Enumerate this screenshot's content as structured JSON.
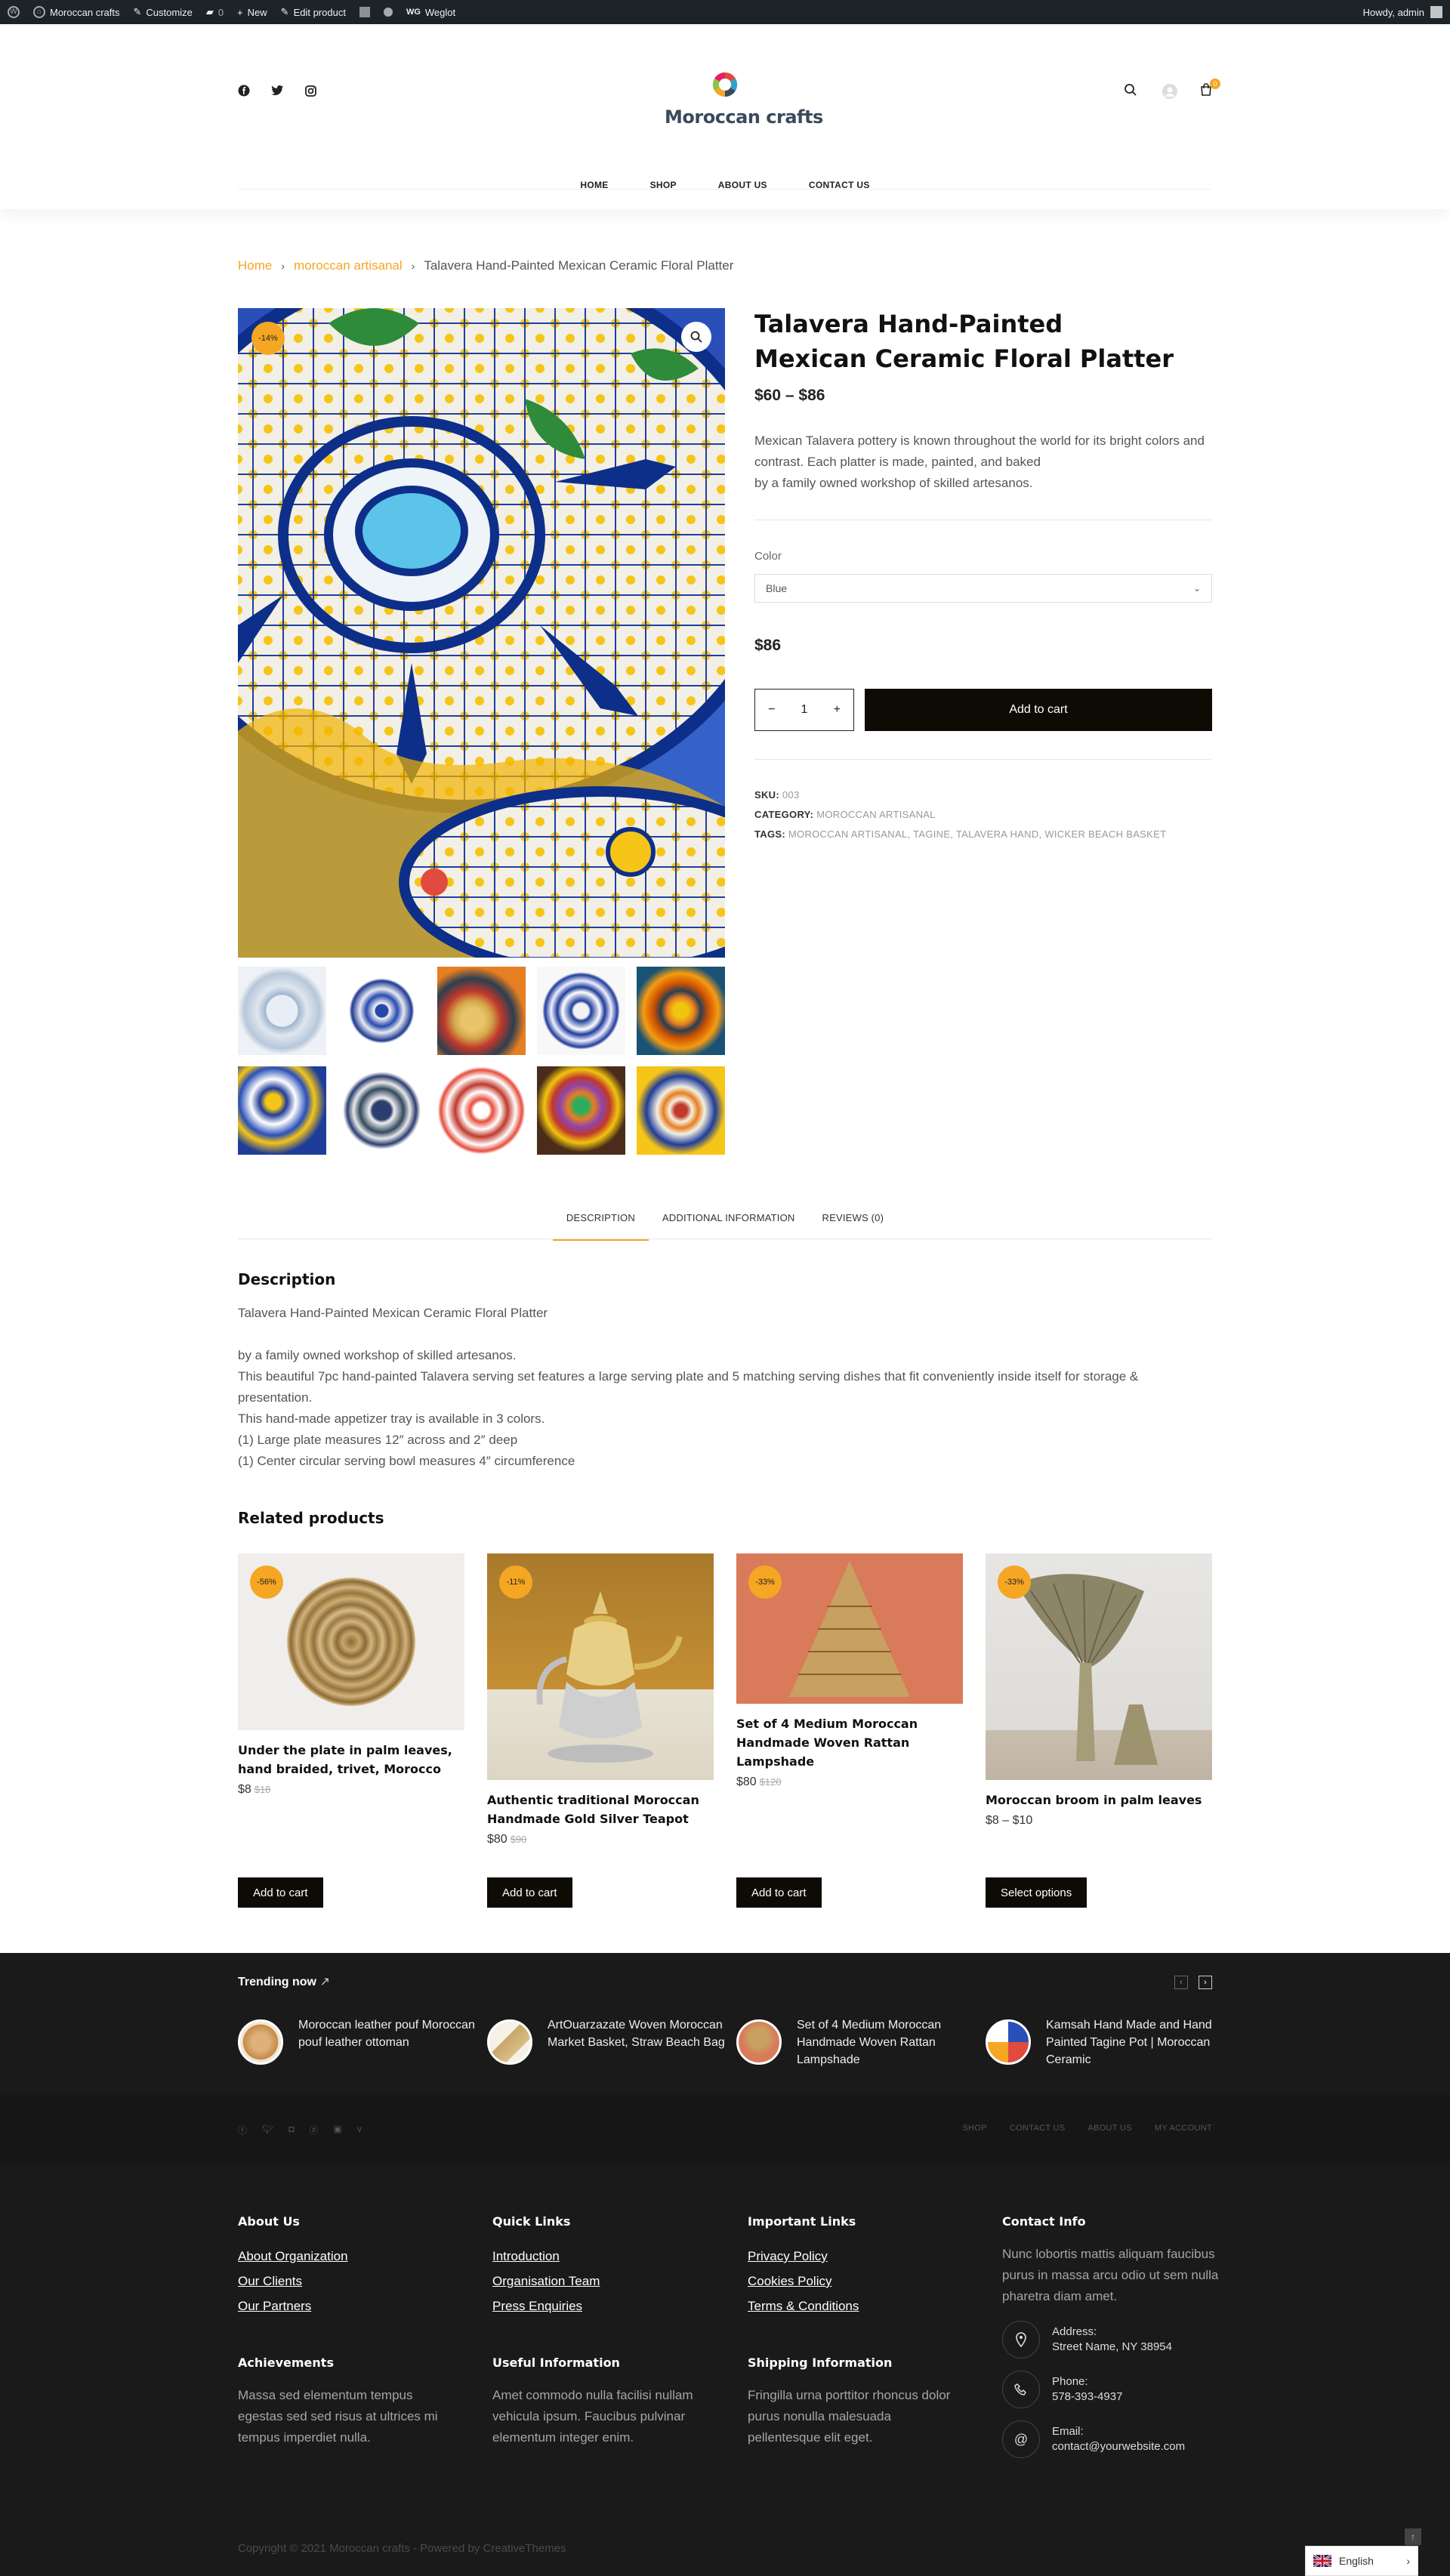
{
  "admin_bar": {
    "site_name": "Moroccan crafts",
    "customize": "Customize",
    "comments": "0",
    "new": "New",
    "edit_product": "Edit product",
    "weglot_badge": "WG",
    "weglot": "Weglot",
    "howdy": "Howdy, admin"
  },
  "header": {
    "logo_text": "Moroccan crafts",
    "cart_count": "0",
    "social_icons": [
      "facebook-icon",
      "twitter-icon",
      "instagram-icon"
    ]
  },
  "nav": {
    "items": [
      "HOME",
      "SHOP",
      "ABOUT US",
      "CONTACT US"
    ]
  },
  "breadcrumb": {
    "home": "Home",
    "category": "moroccan artisanal",
    "current": "Talavera Hand-Painted Mexican Ceramic Floral Platter"
  },
  "product": {
    "sale_badge": "-14%",
    "title": "Talavera Hand-Painted Mexican Ceramic Floral Platter",
    "price_range": "$60 – $86",
    "short_description": "Mexican Talavera pottery is known throughout the world for its bright colors and contrast. Each platter is made, painted, and baked\nby a family owned workshop of skilled artesanos.",
    "color_label": "Color",
    "color_selected": "Blue",
    "variation_price": "$86",
    "quantity": "1",
    "add_to_cart": "Add to cart",
    "sku_label": "SKU:",
    "sku": "003",
    "category_label": "CATEGORY:",
    "category": "MOROCCAN ARTISANAL",
    "tags_label": "TAGS:",
    "tags": "MOROCCAN ARTISANAL, TAGINE, TALAVERA HAND, WICKER BEACH BASKET"
  },
  "tabs": [
    "DESCRIPTION",
    "ADDITIONAL INFORMATION",
    "REVIEWS (0)"
  ],
  "description": {
    "title": "Description",
    "lines": [
      "Talavera Hand-Painted Mexican Ceramic Floral Platter",
      "",
      "by a family owned workshop of skilled artesanos.",
      "This beautiful 7pc hand-painted Talavera serving set features a large serving plate and 5 matching serving dishes that fit conveniently inside itself for storage & presentation.",
      "This hand-made appetizer tray is available in 3 colors.",
      "(1) Large plate measures 12″ across and 2″ deep",
      "(1) Center circular serving bowl measures 4″ circumference"
    ]
  },
  "related": {
    "title": "Related products",
    "products": [
      {
        "badge": "-56%",
        "name": "Under the plate in palm leaves, hand braided, trivet, Morocco",
        "price": "$8",
        "old_price": "$18",
        "button": "Add to cart"
      },
      {
        "badge": "-11%",
        "name": "Authentic traditional Moroccan Handmade Gold Silver Teapot",
        "price": "$80",
        "old_price": "$90",
        "button": "Add to cart"
      },
      {
        "badge": "-33%",
        "name": "Set of 4 Medium Moroccan Handmade Woven Rattan Lampshade",
        "price": "$80",
        "old_price": "$120",
        "button": "Add to cart"
      },
      {
        "badge": "-33%",
        "name": "Moroccan broom in palm leaves",
        "price": "$8 – $10",
        "old_price": "",
        "button": "Select options"
      }
    ]
  },
  "trending": {
    "title": "Trending now",
    "items": [
      "Moroccan leather pouf Moroccan pouf leather ottoman",
      "ArtOuarzazate Woven Moroccan Market Basket, Straw Beach Bag",
      "Set of 4 Medium Moroccan Handmade Woven Rattan Lampshade",
      "Kamsah Hand Made and Hand Painted Tagine Pot | Moroccan Ceramic"
    ]
  },
  "footer_bar": {
    "links": [
      "SHOP",
      "CONTACT US",
      "ABOUT US",
      "MY ACCOUNT"
    ],
    "social_icons": [
      "facebook-icon",
      "twitter-icon",
      "instagram-icon",
      "pinterest-icon",
      "youtube-icon",
      "vimeo-icon"
    ]
  },
  "footer": {
    "about": {
      "title": "About Us",
      "links": [
        "About Organization",
        "Our Clients",
        "Our Partners"
      ]
    },
    "quick": {
      "title": "Quick Links",
      "links": [
        "Introduction",
        "Organisation Team",
        "Press Enquiries"
      ]
    },
    "important": {
      "title": "Important Links",
      "links": [
        "Privacy Policy",
        "Cookies Policy",
        "Terms & Conditions"
      ]
    },
    "contact": {
      "title": "Contact Info",
      "text": "Nunc lobortis mattis aliquam faucibus purus in massa arcu odio ut sem nulla pharetra diam amet.",
      "address_label": "Address:",
      "address": "Street Name, NY 38954",
      "phone_label": "Phone:",
      "phone": "578-393-4937",
      "email_label": "Email:",
      "email": "contact@yourwebsite.com"
    },
    "achievements": {
      "title": "Achievements",
      "text": "Massa sed elementum tempus egestas sed sed risus at ultrices mi tempus imperdiet nulla."
    },
    "useful": {
      "title": "Useful Information",
      "text": "Amet commodo nulla facilisi nullam vehicula ipsum. Faucibus pulvinar elementum integer enim."
    },
    "shipping": {
      "title": "Shipping Information",
      "text": "Fringilla urna porttitor rhoncus dolor purus nonulla malesuada pellentesque elit eget."
    },
    "copyright": "Copyright © 2021 Moroccan crafts - Powered by CreativeThemes"
  },
  "language": {
    "label": "English"
  },
  "colors": {
    "accent": "#f5a623",
    "dark": "#0e0b05",
    "footer": "#1a1a1a"
  }
}
